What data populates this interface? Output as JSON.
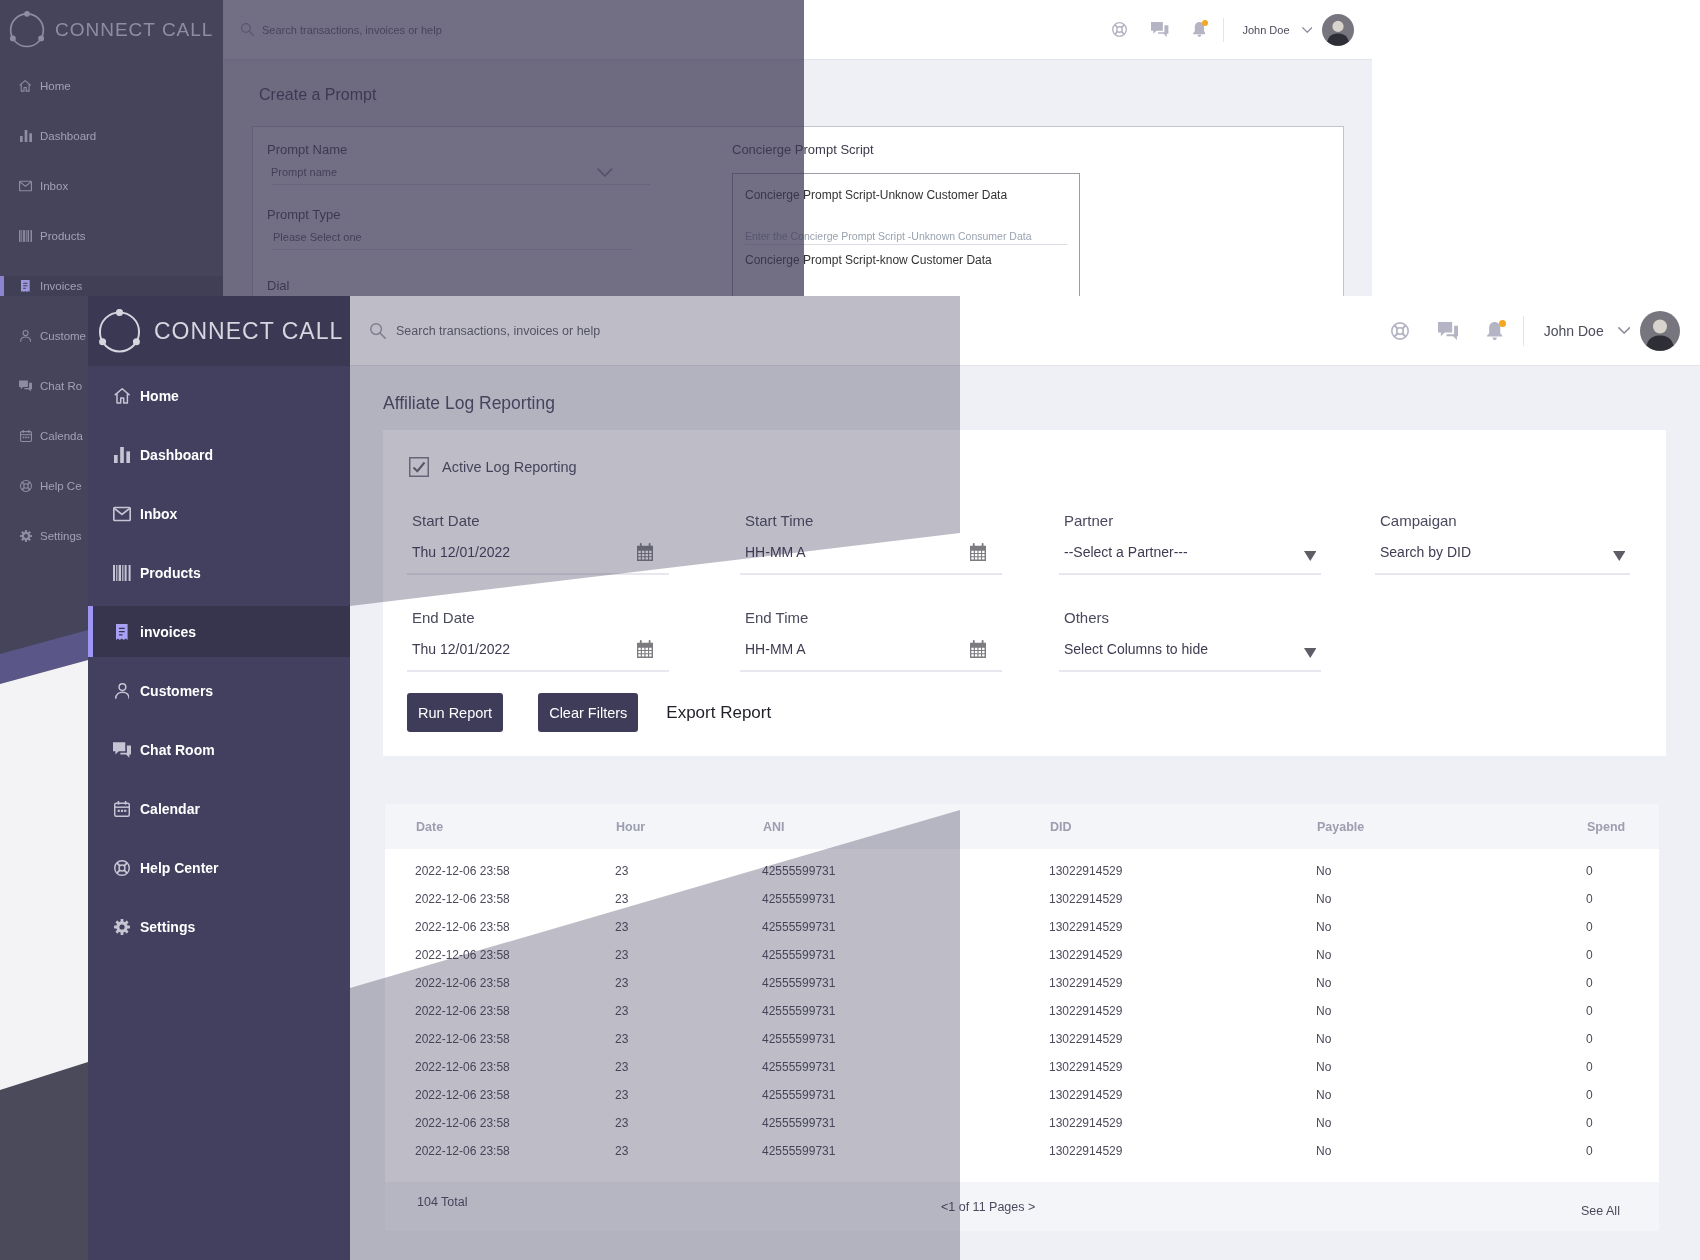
{
  "background_screen": {
    "logo": "CONNECT CALL",
    "header": {
      "search": {
        "placeholder": "Search transactions, invoices or help"
      },
      "notifications_unread": true,
      "user_name": "John Doe"
    },
    "sidebar": {
      "items": [
        {
          "label": "Home",
          "selected": false
        },
        {
          "label": "Dashboard",
          "selected": false
        },
        {
          "label": "Inbox",
          "selected": false
        },
        {
          "label": "Products",
          "selected": false
        },
        {
          "label": "Invoices",
          "selected": true
        },
        {
          "label": "Custome",
          "selected": false
        },
        {
          "label": "Chat Ro",
          "selected": false
        },
        {
          "label": "Calenda",
          "selected": false
        },
        {
          "label": "Help Ce",
          "selected": false
        },
        {
          "label": "Settings",
          "selected": false
        }
      ]
    },
    "page_title": "Create a Prompt",
    "form": {
      "fields": [
        {
          "label": "Prompt Name",
          "placeholder": "Prompt name",
          "kind": "dropdown"
        },
        {
          "label": "Prompt Type",
          "placeholder": "Please Select one",
          "kind": "text"
        },
        {
          "label": "Dial"
        }
      ]
    },
    "script_panel": {
      "title": "Concierge Prompt Script",
      "entries": [
        {
          "label": "Concierge Prompt Script-Unknow Customer Data",
          "placeholder": "Enter the Concierge Prompt Script -Unknown Consumer Data"
        },
        {
          "label": "Concierge Prompt Script-know Customer Data"
        }
      ]
    }
  },
  "foreground_screen": {
    "logo": "CONNECT CALL",
    "header": {
      "search": {
        "placeholder": "Search transactions, invoices or help"
      },
      "notifications_unread": true,
      "user_name": "John Doe"
    },
    "sidebar": {
      "items": [
        {
          "label": "Home",
          "selected": false
        },
        {
          "label": "Dashboard",
          "selected": false
        },
        {
          "label": "Inbox",
          "selected": false
        },
        {
          "label": "Products",
          "selected": false
        },
        {
          "label": "invoices",
          "selected": true
        },
        {
          "label": "Customers",
          "selected": false
        },
        {
          "label": "Chat Room",
          "selected": false
        },
        {
          "label": "Calendar",
          "selected": false
        },
        {
          "label": "Help Center",
          "selected": false
        },
        {
          "label": "Settings",
          "selected": false
        }
      ]
    },
    "page_title": "Affiliate Log Reporting",
    "filters": {
      "active_log_reporting": {
        "label": "Active Log Reporting",
        "checked": true
      },
      "fields": [
        {
          "label": "Start Date",
          "value": "Thu 12/01/2022",
          "kind": "picker"
        },
        {
          "label": "Start Time",
          "value": "HH-MM A",
          "kind": "picker"
        },
        {
          "label": "Partner",
          "value": "--Select a Partner---",
          "kind": "select"
        },
        {
          "label": "Campaigan",
          "value": "Search by DID",
          "kind": "select"
        },
        {
          "label": "End Date",
          "value": "Thu 12/01/2022",
          "kind": "picker"
        },
        {
          "label": "End Time",
          "value": "HH-MM A",
          "kind": "picker"
        },
        {
          "label": "Others",
          "value": "Select Columns to hide",
          "kind": "select"
        }
      ],
      "buttons": [
        {
          "label": "Run Report",
          "kind": "primary"
        },
        {
          "label": "Clear Filters",
          "kind": "primary"
        },
        {
          "label": "Export Report",
          "kind": "link"
        }
      ]
    },
    "table": {
      "columns": [
        "Date",
        "Hour",
        "ANI",
        "DID",
        "Payable",
        "Spend"
      ],
      "rows": [
        [
          "2022-12-06 23:58",
          "23",
          "42555599731",
          "13022914529",
          "No",
          "0"
        ],
        [
          "2022-12-06 23:58",
          "23",
          "42555599731",
          "13022914529",
          "No",
          "0"
        ],
        [
          "2022-12-06 23:58",
          "23",
          "42555599731",
          "13022914529",
          "No",
          "0"
        ],
        [
          "2022-12-06 23:58",
          "23",
          "42555599731",
          "13022914529",
          "No",
          "0"
        ],
        [
          "2022-12-06 23:58",
          "23",
          "42555599731",
          "13022914529",
          "No",
          "0"
        ],
        [
          "2022-12-06 23:58",
          "23",
          "42555599731",
          "13022914529",
          "No",
          "0"
        ],
        [
          "2022-12-06 23:58",
          "23",
          "42555599731",
          "13022914529",
          "No",
          "0"
        ],
        [
          "2022-12-06 23:58",
          "23",
          "42555599731",
          "13022914529",
          "No",
          "0"
        ],
        [
          "2022-12-06 23:58",
          "23",
          "42555599731",
          "13022914529",
          "No",
          "0"
        ],
        [
          "2022-12-06 23:58",
          "23",
          "42555599731",
          "13022914529",
          "No",
          "0"
        ],
        [
          "2022-12-06 23:58",
          "23",
          "42555599731",
          "13022914529",
          "No",
          "0"
        ]
      ],
      "footer": {
        "total": "104 Total",
        "pagination": "<1 of 11 Pages >",
        "see_all": "See All"
      }
    }
  }
}
